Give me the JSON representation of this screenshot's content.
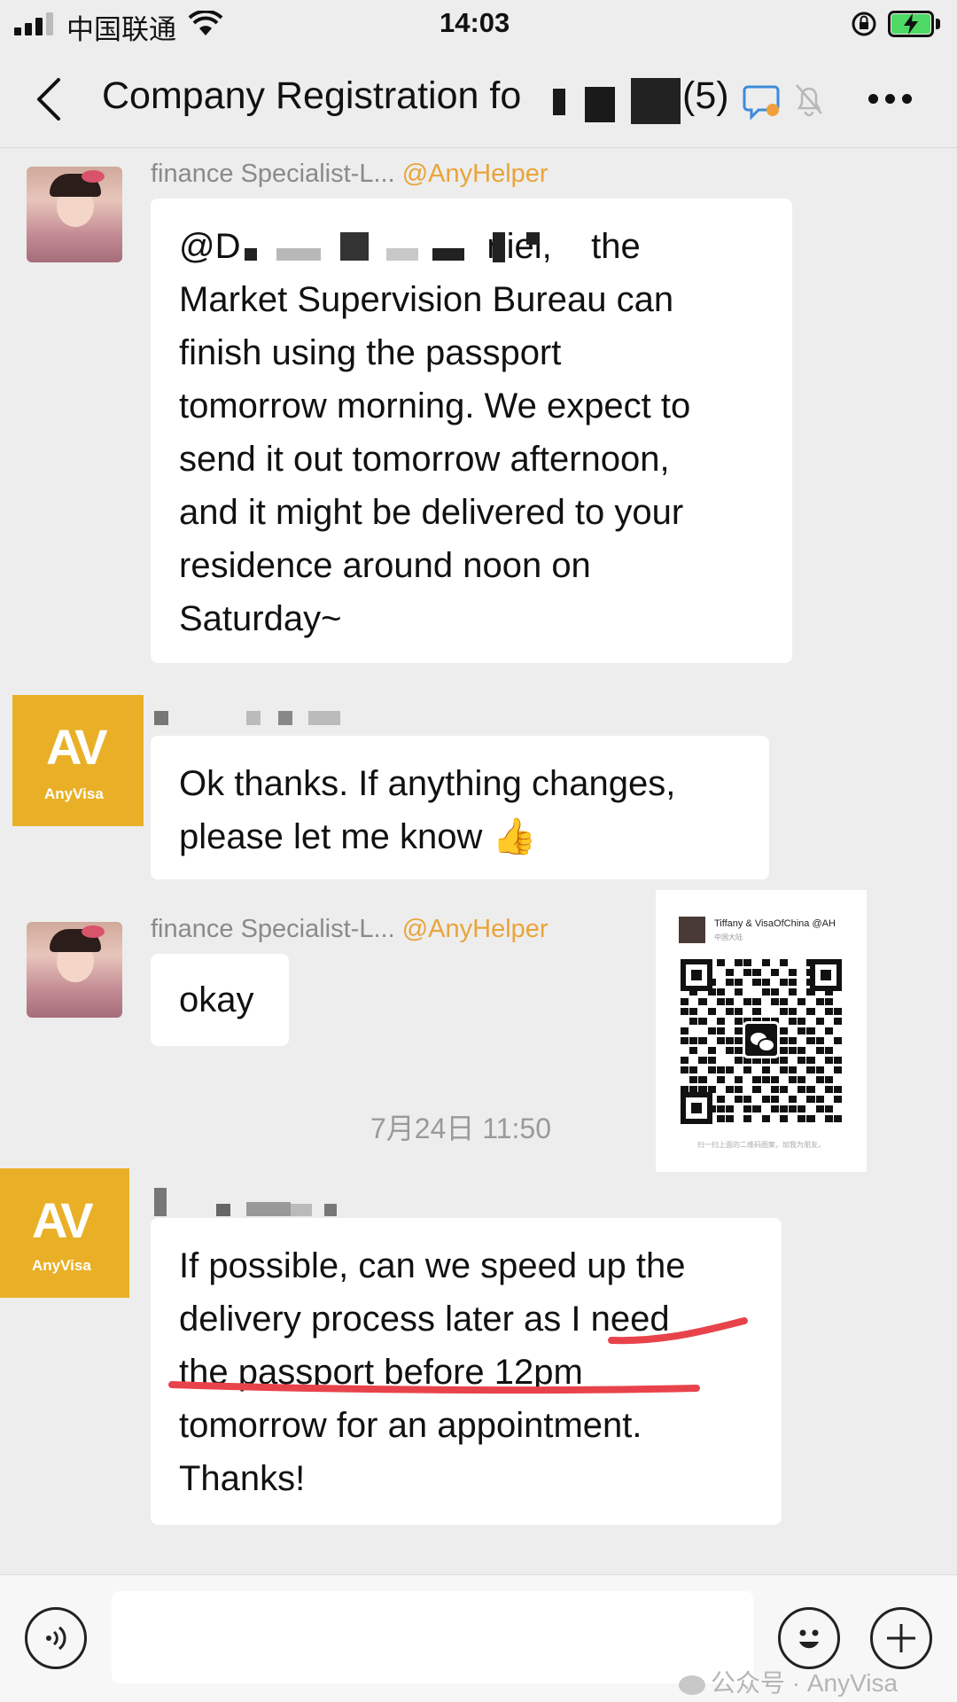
{
  "status_bar": {
    "carrier": "中国联通",
    "time": "14:03"
  },
  "header": {
    "title_prefix": "Company Registration fo",
    "title_suffix": "(5)",
    "more_icon": "more-dots-icon",
    "back_icon": "chevron-left-icon"
  },
  "messages": [
    {
      "sender": "finance  Specialist-L...",
      "mention": "@AnyHelper",
      "text": "@D                         niel,    the\nMarket Supervision Bureau can\nfinish using the passport\ntomorrow morning. We expect to\nsend it out tomorrow afternoon,\nand it might be delivered to your\nresidence around noon on\nSaturday~"
    },
    {
      "avatar_text": "AnyVisa",
      "text": "Ok thanks. If anything changes,\nplease let me know 👍"
    },
    {
      "sender": "finance  Specialist-L...",
      "mention": "@AnyHelper",
      "text": "okay"
    },
    {
      "avatar_text": "AnyVisa",
      "text": "If possible, can we speed up the\ndelivery process later as I need\nthe passport before 12pm\ntomorrow for an appointment.\nThanks!"
    }
  ],
  "timestamp": "7月24日 11:50",
  "qr_card": {
    "name": "Tiffany & VisaOfChina @AH",
    "region": "中国大陆",
    "caption": "扫一扫上面的二维码图案，加我为朋友。"
  },
  "input_bar": {
    "watermark": "公众号 · AnyVisa"
  },
  "colors": {
    "background": "#ededed",
    "bubble": "#ffffff",
    "mention": "#e9a43a",
    "anyvisa_brand": "#e9b027",
    "annotation_red": "#e8434b"
  }
}
